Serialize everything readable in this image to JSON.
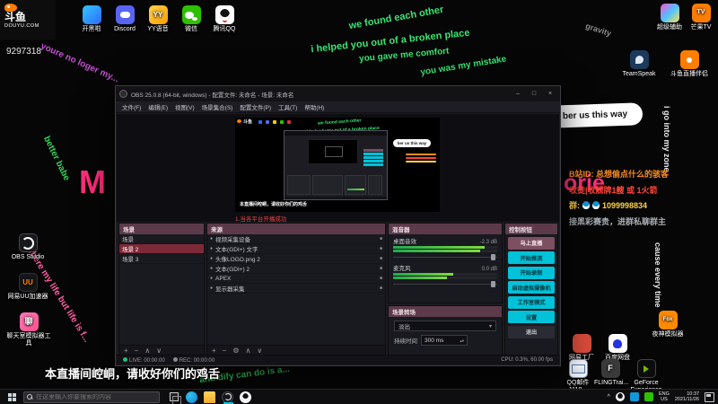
{
  "desktop": {
    "logo": {
      "name": "斗鱼",
      "domain": "DOUYU.COM"
    },
    "room_id": "9297318",
    "icons_top": [
      "开黑啦",
      "Discord",
      "YY语音",
      "微信",
      "腾讯QQ"
    ],
    "icons_left": [
      "OBS Studio",
      "网易UU加速器",
      "聊天室模拟器工具"
    ],
    "icons_right_top": [
      "超级辅助",
      "芒果TV",
      "TeamSpeak",
      "斗鱼直播伴侣"
    ],
    "icons_bottom_right": [
      "夜神模拟器",
      "网易工厂",
      "百度网盘",
      "QQ邮件1110...",
      "FLINGTrai...",
      "GeForce Experience"
    ],
    "lyrics": [
      {
        "text": "we found each other",
        "color": "#3ae374"
      },
      {
        "text": "i helped you out of a broken place",
        "color": "#3ae374"
      },
      {
        "text": "you gave me comfort",
        "color": "#3ae374"
      },
      {
        "text": "you was my mistake",
        "color": "#3ae374"
      },
      {
        "text": "youre no loger my...",
        "color": "#c44fd0"
      },
      {
        "text": "better babe",
        "color": "#35d05a"
      },
      {
        "text": "where my life but life is f...",
        "color": "#ff5fa2"
      },
      {
        "text": "gravity",
        "color": "#8a8a8a"
      },
      {
        "text": "i go into my zone",
        "color": "#e8e8e8"
      },
      {
        "text": "cause every time",
        "color": "#e8e8e8"
      },
      {
        "text": "and dify can do is a...",
        "color": "#35d05a"
      }
    ],
    "big_text": {
      "left": "M",
      "right": "orie",
      "color": "#ff2d7a"
    },
    "bubble": "ber us this way",
    "info": [
      {
        "text": "B站ID: 总想偷点什么的骇客",
        "color": "#ff8c1a"
      },
      {
        "text": "收徒|收舰牌1艘 或 1火箭",
        "color": "#ff4438"
      },
      {
        "label": "群:",
        "number": "1099998834",
        "color": "#ffd24a"
      },
      {
        "text": "接黑彩赛贵，进群私聊群主",
        "color": "#a8adb3"
      }
    ],
    "subtitle": "本直播间崆峒，请收好你们的鸡舌"
  },
  "obs": {
    "title": "OBS 25.0.8 (64-bit, windows) - 配置文件: 未命名 - 场景: 未命名",
    "window_controls": {
      "min": "–",
      "max": "□",
      "close": "×"
    },
    "menu": [
      "文件(F)",
      "编辑(E)",
      "视图(V)",
      "场景集合(S)",
      "配置文件(P)",
      "工具(T)",
      "帮助(H)"
    ],
    "preview_tip": "1.当各平台开播成功",
    "dock_tools": {
      "add": "+",
      "remove": "−",
      "gear": "⚙",
      "up": "∧",
      "down": "∨"
    },
    "scenes": {
      "title": "场景",
      "items": [
        "场景",
        "场景 2",
        "场景 3"
      ],
      "selected_index": 1
    },
    "sources": {
      "title": "来源",
      "items": [
        "视频采集设备",
        "文本(GDI+) 文字",
        "头像LOGO.png 2",
        "文本(GDI+) 2",
        "APEX",
        "显示器采集"
      ]
    },
    "mixer": {
      "title": "混音器",
      "channels": [
        {
          "name": "桌面音效",
          "db": "-2.3 dB"
        },
        {
          "name": "麦克风",
          "db": "0.0 dB"
        }
      ]
    },
    "transitions": {
      "title": "场景转场",
      "value": "淡出",
      "caret": "▾",
      "duration_label": "持续时间",
      "duration": "300 ms",
      "arrows": "▴▾"
    },
    "controls": {
      "title": "控制按钮",
      "buttons": [
        {
          "label": "马上直播",
          "style": "mauve"
        },
        {
          "label": "开始推流",
          "style": "cyan"
        },
        {
          "label": "开始录制",
          "style": "cyan"
        },
        {
          "label": "启动虚拟摄像机",
          "style": "cyan"
        },
        {
          "label": "工作室模式",
          "style": "cyan"
        },
        {
          "label": "设置",
          "style": "cyan"
        },
        {
          "label": "退出",
          "style": "dark"
        }
      ]
    },
    "status": {
      "live": "LIVE: 00:00:00",
      "rec": "REC: 00:00:00",
      "cpu": "CPU: 0.3%, 60.00 fps"
    }
  },
  "taskbar": {
    "search_placeholder": "在这里输入你要搜索的内容",
    "caret": "^",
    "lang": "ENG",
    "region": "US",
    "time": "10:37",
    "date": "2021/11/26"
  }
}
